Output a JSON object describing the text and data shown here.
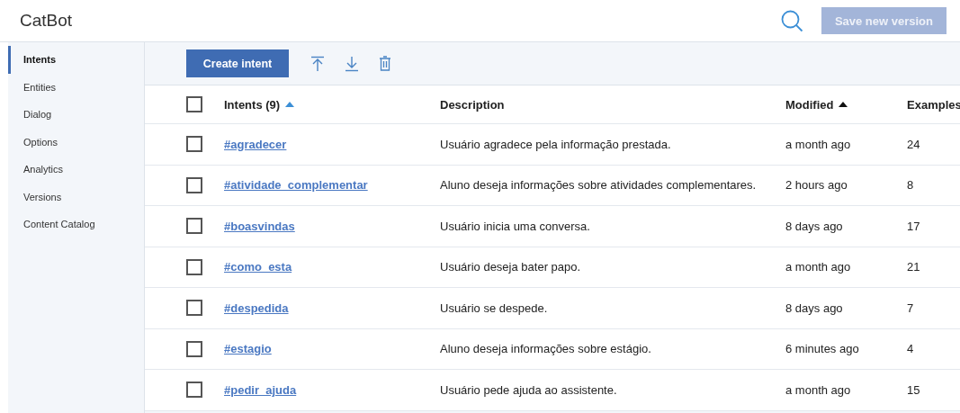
{
  "header": {
    "title": "CatBot",
    "save_button": {
      "label": "Save new version",
      "disabled": true
    }
  },
  "sidebar": {
    "items": [
      {
        "label": "Intents",
        "selected": true
      },
      {
        "label": "Entities",
        "selected": false
      },
      {
        "label": "Dialog",
        "selected": false
      },
      {
        "label": "Options",
        "selected": false
      },
      {
        "label": "Analytics",
        "selected": false
      },
      {
        "label": "Versions",
        "selected": false
      },
      {
        "label": "Content Catalog",
        "selected": false
      }
    ]
  },
  "toolbar": {
    "create_button": "Create intent"
  },
  "table": {
    "select_all": {
      "checked": false
    },
    "columns": [
      {
        "label": "Intents (9)",
        "sort_active": true
      },
      {
        "label": "Description"
      },
      {
        "label": "Modified",
        "sort_active": false
      },
      {
        "label": "Examples"
      }
    ],
    "rows": [
      {
        "checked": false,
        "intent": "#agradecer",
        "description": "Usuário agradece pela informação prestada.",
        "modified": "a month ago",
        "examples": "24"
      },
      {
        "checked": false,
        "intent": "#atividade_complementar",
        "description": "Aluno deseja informações sobre atividades complementares.",
        "modified": "2 hours ago",
        "examples": "8"
      },
      {
        "checked": false,
        "intent": "#boasvindas",
        "description": "Usuário inicia uma conversa.",
        "modified": "8 days ago",
        "examples": "17"
      },
      {
        "checked": false,
        "intent": "#como_esta",
        "description": "Usuário deseja bater papo.",
        "modified": "a month ago",
        "examples": "21"
      },
      {
        "checked": false,
        "intent": "#despedida",
        "description": "Usuário se despede.",
        "modified": "8 days ago",
        "examples": "7"
      },
      {
        "checked": false,
        "intent": "#estagio",
        "description": "Aluno deseja informações sobre estágio.",
        "modified": "6 minutes ago",
        "examples": "4"
      },
      {
        "checked": false,
        "intent": "#pedir_ajuda",
        "description": "Usuário pede ajuda ao assistente.",
        "modified": "a month ago",
        "examples": "15"
      }
    ]
  }
}
